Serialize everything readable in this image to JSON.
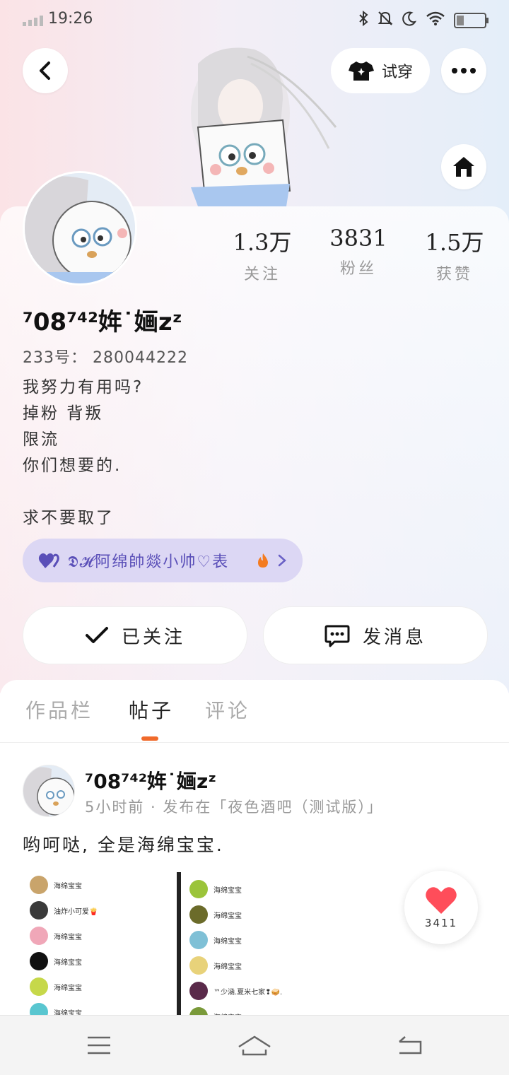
{
  "status_bar": {
    "time": "19:26",
    "battery_level": 0.25
  },
  "header": {
    "try_on_label": "试穿"
  },
  "profile": {
    "stats": [
      {
        "value": "1.3万",
        "label": "关注"
      },
      {
        "value": "3831",
        "label": "粉丝"
      },
      {
        "value": "1.5万",
        "label": "获赞"
      }
    ],
    "username": "⁷08⁷⁴²姩˙婳zᶻ",
    "uid": "233号：  280044222",
    "bio_lines": [
      "我努力有用吗?",
      "掉粉  背叛",
      "限流",
      "你们想要的.",
      "",
      "求不要取了"
    ],
    "medal_text": "𝕯𝓗阿绵帥燚小帅♡表"
  },
  "actions": {
    "follow_label": "已关注",
    "message_label": "发消息"
  },
  "tabs": [
    {
      "label": "作品栏",
      "active": false
    },
    {
      "label": "帖子",
      "active": true
    },
    {
      "label": "评论",
      "active": false
    }
  ],
  "post": {
    "author": "⁷08⁷⁴²姩˙婳zᶻ",
    "meta": "5小时前 · 发布在「夜色酒吧（测试版）」",
    "text": "哟呵哒, 全是海绵宝宝.",
    "image_left": [
      {
        "name": "海绵宝宝",
        "color": "#c9a46b"
      },
      {
        "name": "油炸小可爱🍟",
        "color": "#3a3a3a"
      },
      {
        "name": "海绵宝宝",
        "color": "#f0a7b8"
      },
      {
        "name": "海绵宝宝",
        "color": "#111111"
      },
      {
        "name": "海绵宝宝",
        "color": "#c6d84a"
      },
      {
        "name": "海绵宝宝",
        "color": "#59c6d0"
      }
    ],
    "image_right": [
      {
        "name": "海绵宝宝",
        "color": "#9bc43a"
      },
      {
        "name": "海绵宝宝",
        "color": "#6b6b2a"
      },
      {
        "name": "海绵宝宝",
        "color": "#7fc0d6"
      },
      {
        "name": "海绵宝宝",
        "color": "#e8d27a"
      },
      {
        "name": "™少涵.夏米七家❢🥪.",
        "color": "#5a2a4a"
      },
      {
        "name": "海绵宝宝",
        "color": "#7a9a3a"
      }
    ],
    "likes": "3411"
  },
  "colors": {
    "accent": "#f06a2b",
    "medal_bg": "#dcd7f4",
    "like": "#ff4d5a"
  }
}
